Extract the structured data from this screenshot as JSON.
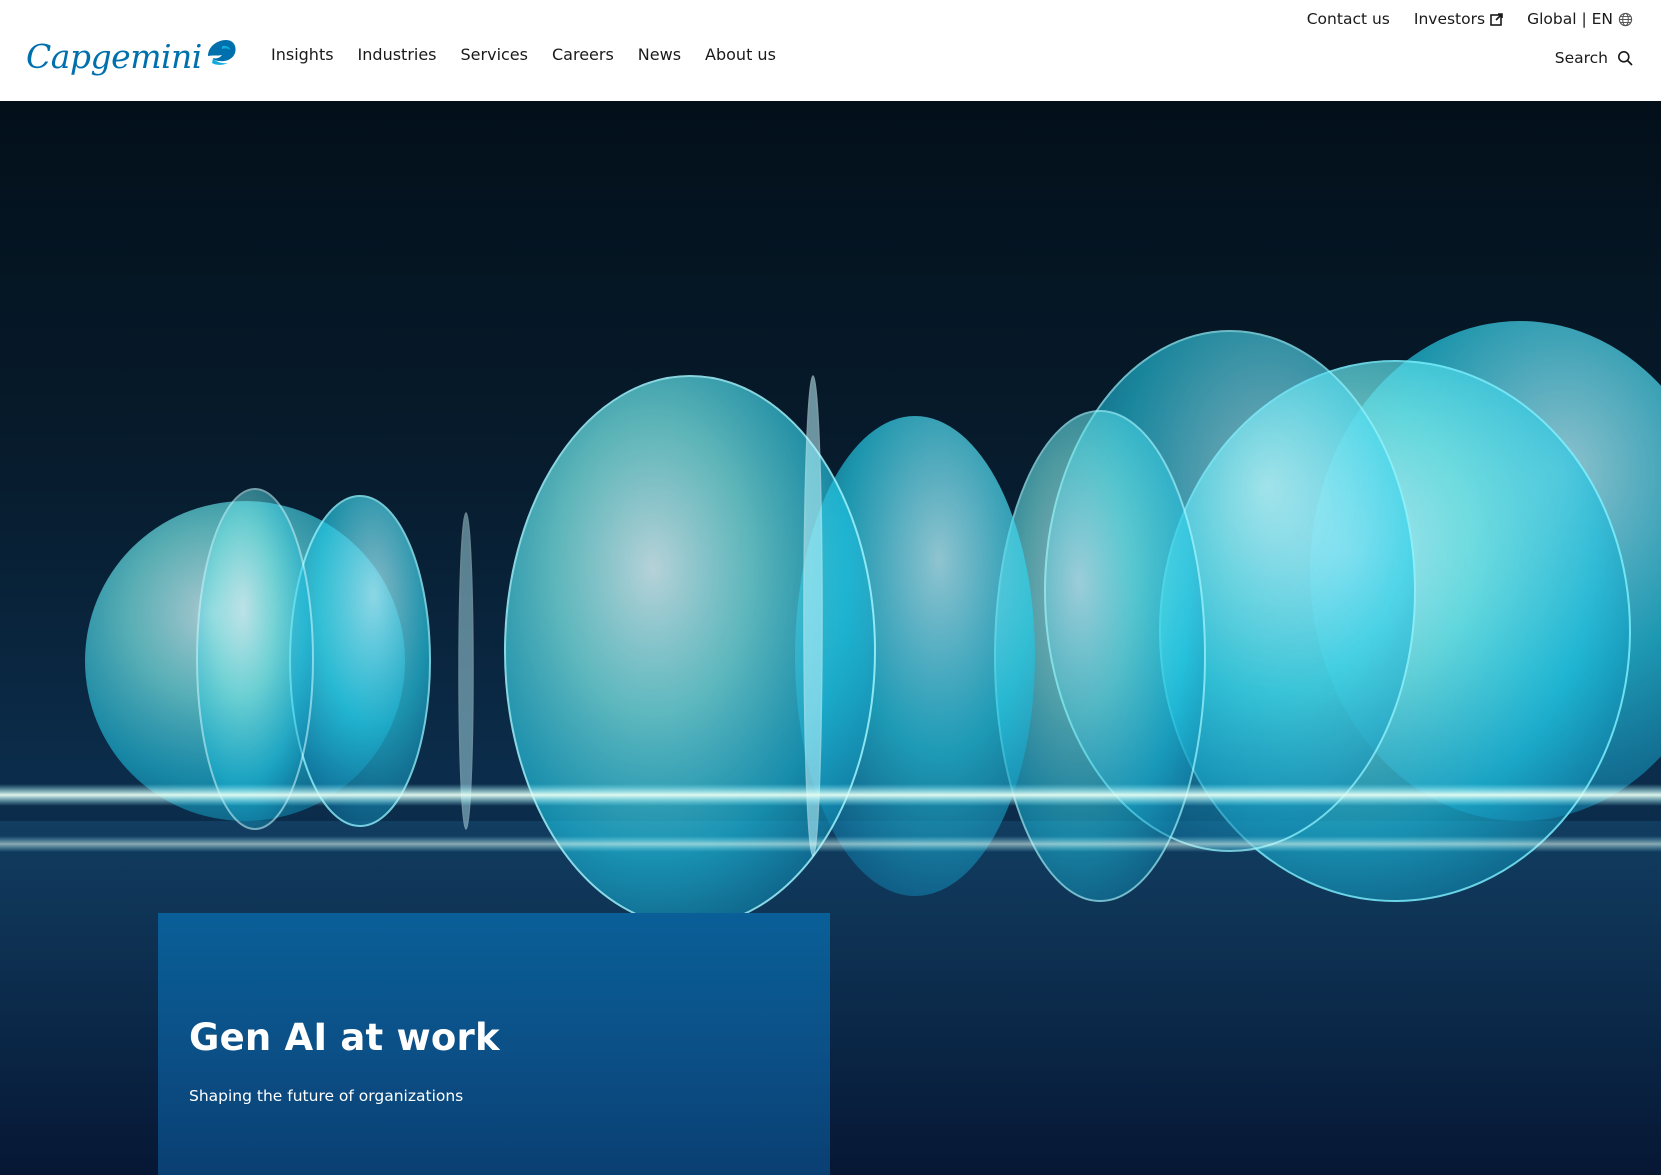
{
  "header": {
    "logo": {
      "text": "Capgemini",
      "icon": "spade-icon",
      "color": "#0070ad"
    },
    "main_nav": [
      {
        "label": "Insights"
      },
      {
        "label": "Industries"
      },
      {
        "label": "Services"
      },
      {
        "label": "Careers"
      },
      {
        "label": "News"
      },
      {
        "label": "About us"
      }
    ],
    "utility_nav": {
      "contact": "Contact us",
      "investors": "Investors",
      "investors_icon": "external-link-icon",
      "region": "Global | EN",
      "region_icon": "globe-icon"
    },
    "search": {
      "label": "Search",
      "icon": "search-icon"
    }
  },
  "hero": {
    "title": "Gen AI at work",
    "subtitle": "Shaping the future of organizations",
    "card_color": "#0b5a92",
    "background_color": "#06162a",
    "accent_color": "#3fe3ef"
  }
}
